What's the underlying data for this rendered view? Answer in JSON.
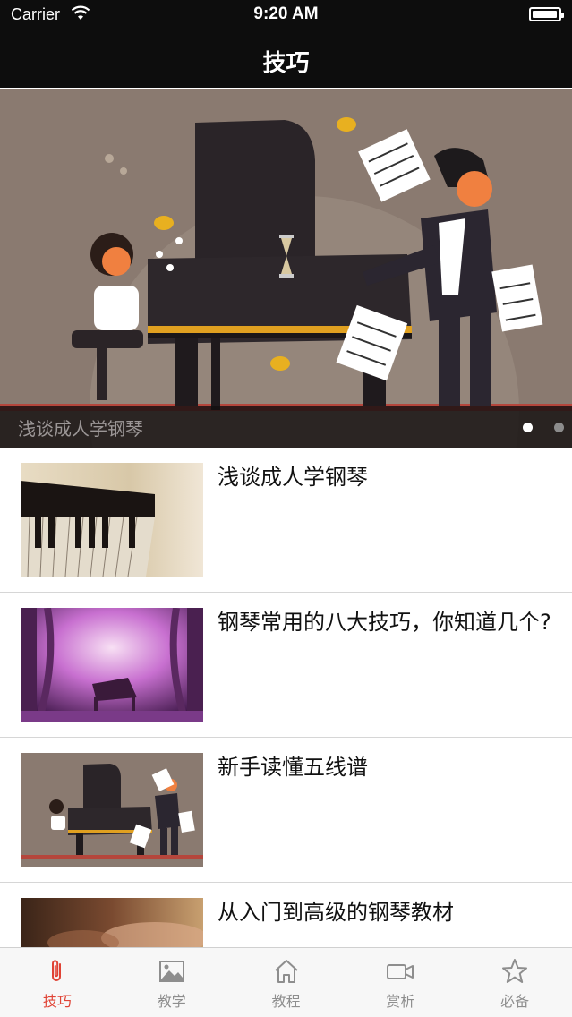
{
  "status_bar": {
    "carrier": "Carrier",
    "time": "9:20 AM",
    "battery_fraction": 0.95
  },
  "nav": {
    "title": "技巧"
  },
  "banner": {
    "caption": "浅谈成人学钢琴",
    "page_count": 2,
    "active_page": 1
  },
  "articles": [
    {
      "title": "浅谈成人学钢琴",
      "thumb": "piano-keys-photo"
    },
    {
      "title": "钢琴常用的八大技巧，你知道几个?",
      "thumb": "purple-forest-piano-photo"
    },
    {
      "title": "新手读懂五线谱",
      "thumb": "piano-cartoon-illustration"
    },
    {
      "title": "从入门到高级的钢琴教材",
      "thumb": "hands-on-piano-photo"
    }
  ],
  "tabs": [
    {
      "label": "技巧",
      "icon": "paperclip-icon",
      "active": true
    },
    {
      "label": "教学",
      "icon": "image-icon",
      "active": false
    },
    {
      "label": "教程",
      "icon": "home-icon",
      "active": false
    },
    {
      "label": "赏析",
      "icon": "video-camera-icon",
      "active": false
    },
    {
      "label": "必备",
      "icon": "star-icon",
      "active": false
    }
  ],
  "colors": {
    "bar_background": "#0d0d0d",
    "tab_active": "#e04335",
    "tab_inactive": "#8e8e8e",
    "banner_background": "#8a7a70"
  }
}
